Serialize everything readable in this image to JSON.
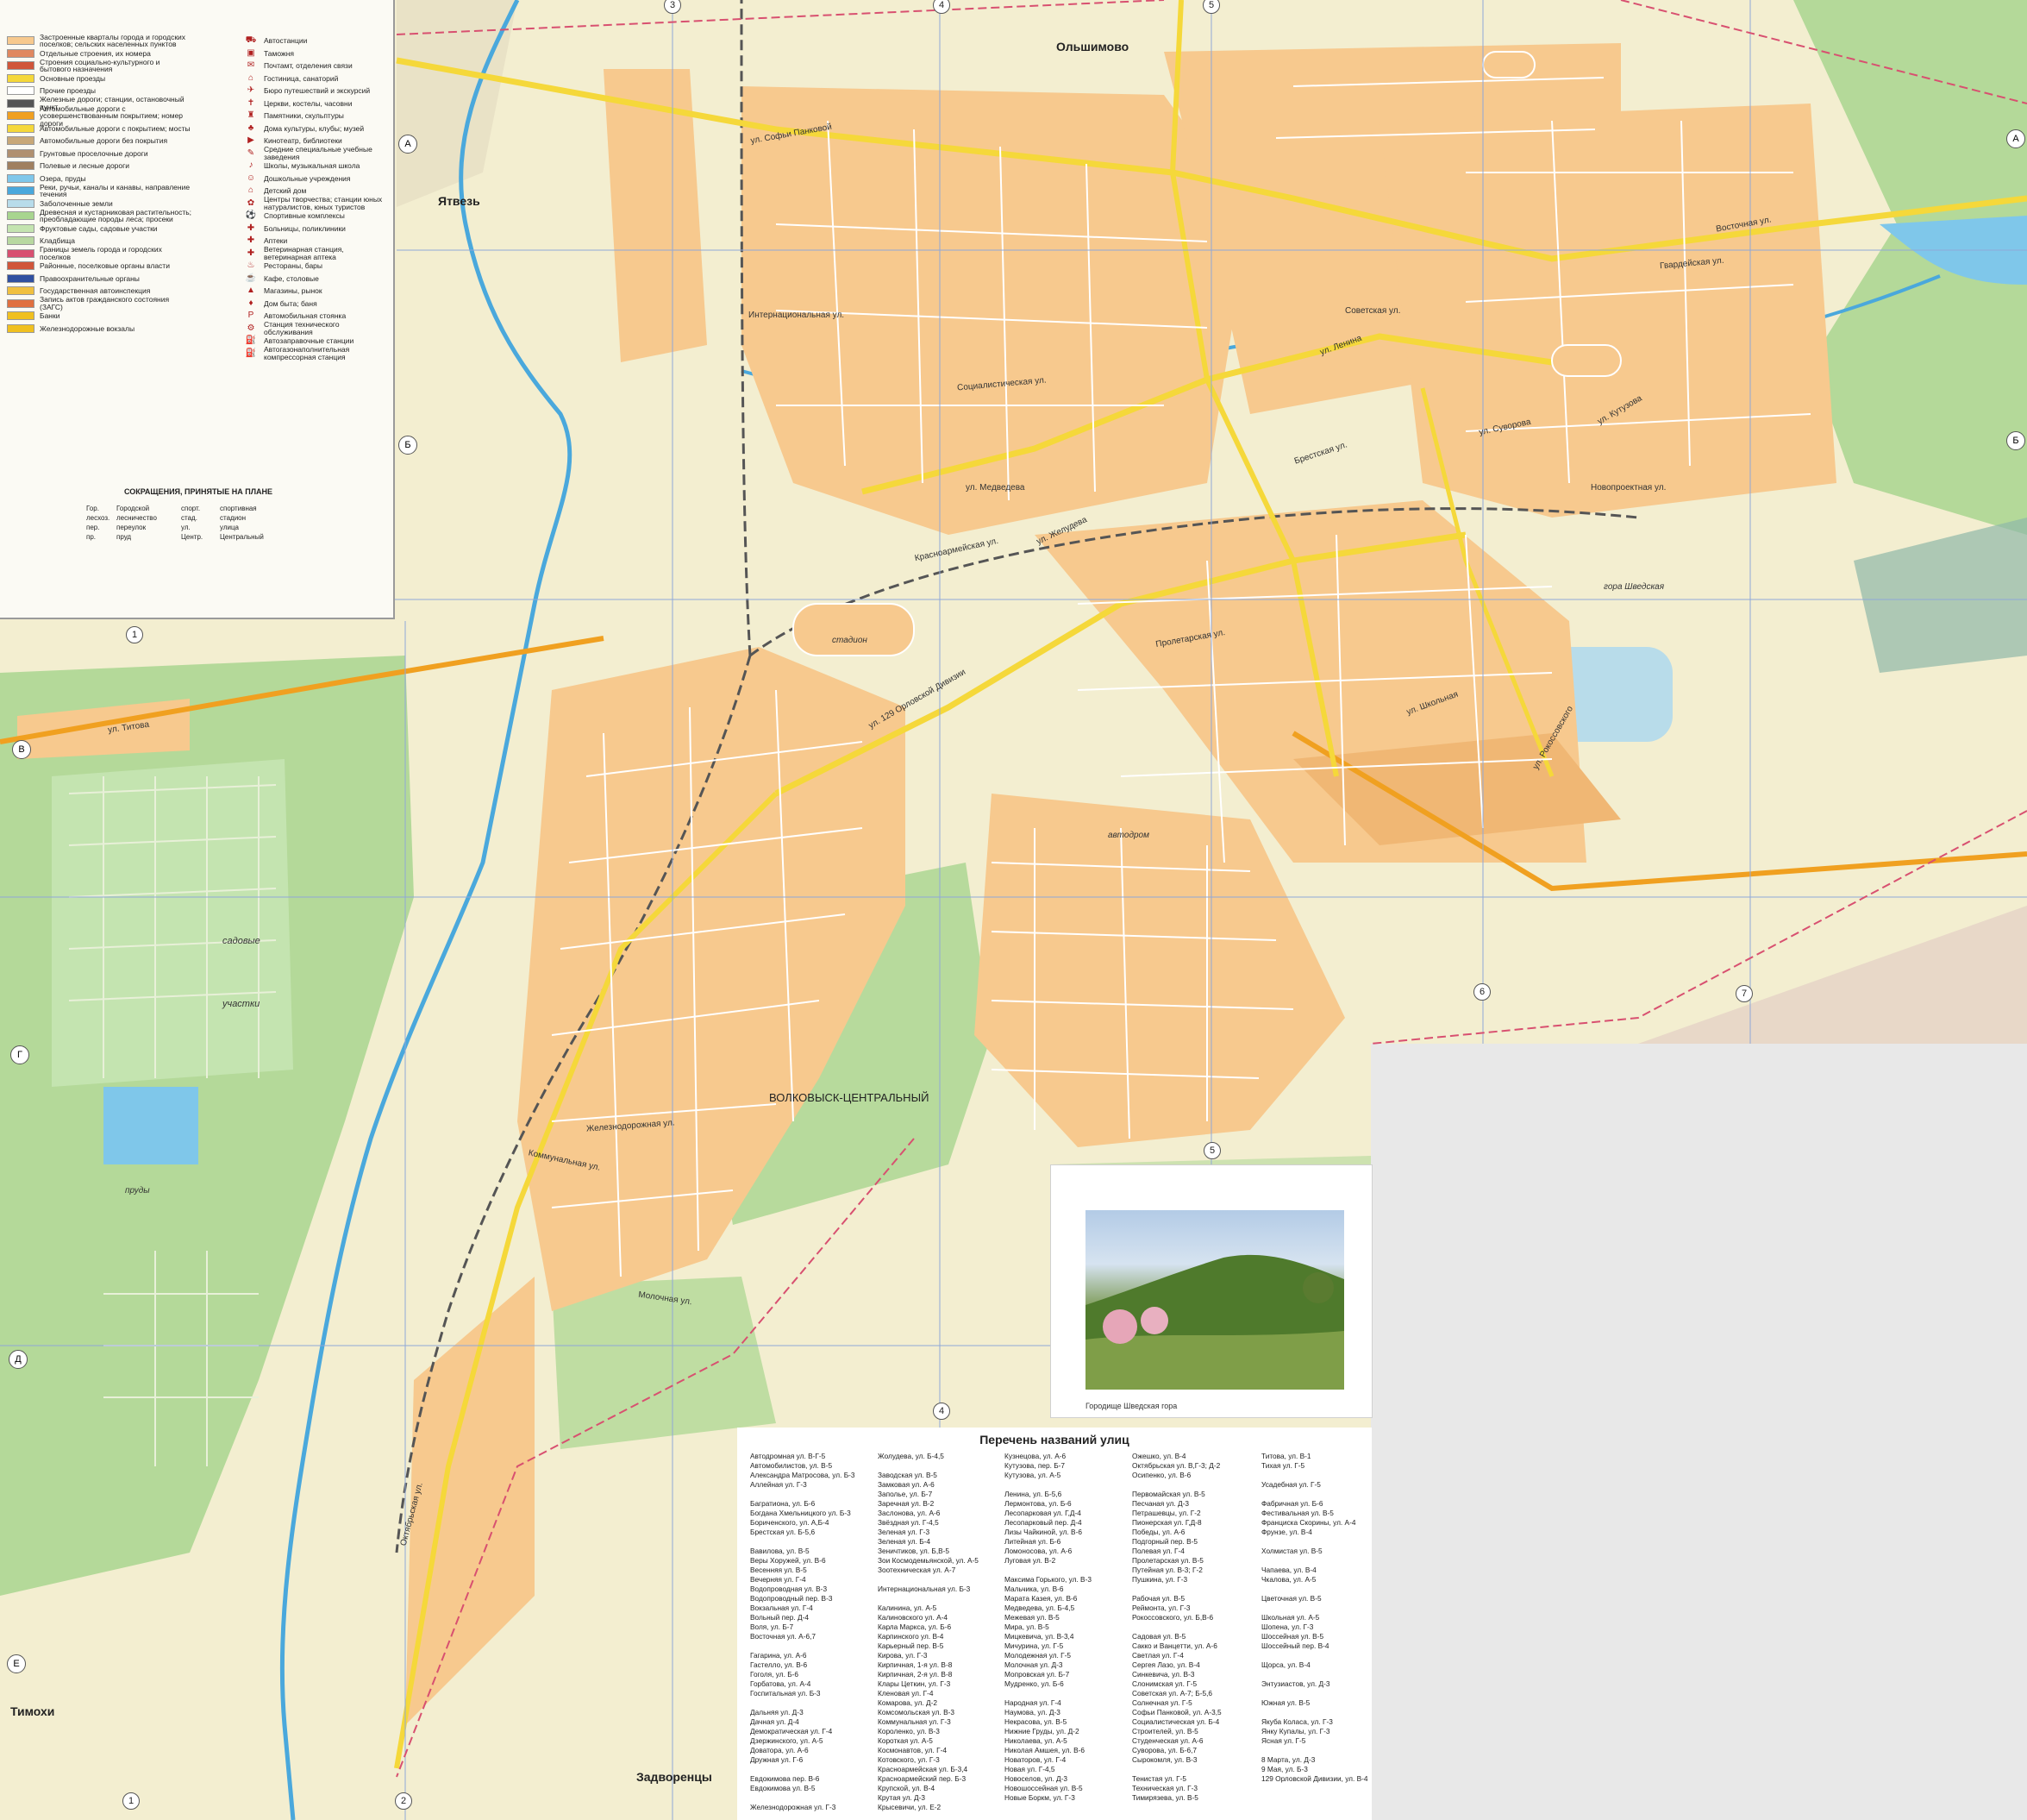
{
  "colors": {
    "background": "#f3eed0",
    "urban": "#f7c98e",
    "residential": "#f0b774",
    "green": "#a8d58f",
    "water": "#7fc7ea",
    "main_road": "#f5d83a",
    "rail": "#555555"
  },
  "legend": {
    "items_left": [
      {
        "label": "Застроенные кварталы города и городских поселков; сельских населенных пунктов",
        "swatch": "#f7c98e"
      },
      {
        "label": "Отдельные строения, их номера",
        "swatch": "#e08860"
      },
      {
        "label": "Строения социально-культурного и бытового назначения",
        "swatch": "#d0563a"
      },
      {
        "label": "Основные проезды",
        "swatch": "#f5d83a"
      },
      {
        "label": "Прочие проезды",
        "swatch": "#ffffff"
      },
      {
        "label": "Железные дороги; станции, остановочный пункт",
        "swatch": "#555555"
      },
      {
        "label": "Автомобильные дороги с усовершенствованным покрытием; номер дороги",
        "swatch": "#f0a020"
      },
      {
        "label": "Автомобильные дороги с покрытием; мосты",
        "swatch": "#f5d83a"
      },
      {
        "label": "Автомобильные дороги без покрытия",
        "swatch": "#c8a878"
      },
      {
        "label": "Грунтовые проселочные дороги",
        "swatch": "#b09070"
      },
      {
        "label": "Полевые и лесные дороги",
        "swatch": "#a08060"
      },
      {
        "label": "Озера, пруды",
        "swatch": "#7fc7ea"
      },
      {
        "label": "Реки, ручьи, каналы и канавы, направление течения",
        "swatch": "#4aa8dc"
      },
      {
        "label": "Заболоченные земли",
        "swatch": "#b8dcea"
      },
      {
        "label": "Древесная и кустарниковая растительность; преобладающие породы леса; просеки",
        "swatch": "#a8d58f"
      },
      {
        "label": "Фруктовые сады, садовые участки",
        "swatch": "#c4e4b0"
      },
      {
        "label": "Кладбища",
        "swatch": "#b8d8a0"
      },
      {
        "label": "Границы земель города и городских поселков",
        "swatch": "#d85070"
      },
      {
        "label": "Районные, поселковые органы власти",
        "swatch": "#d0563a"
      },
      {
        "label": "Правоохранительные органы",
        "swatch": "#3050a0"
      },
      {
        "label": "Государственная автоинспекция",
        "swatch": "#f0c040"
      },
      {
        "label": "Запись актов гражданского состояния (ЗАГС)",
        "swatch": "#e07040"
      },
      {
        "label": "Банки",
        "swatch": "#f0c020"
      },
      {
        "label": "Железнодорожные вокзалы",
        "swatch": "#f0c020"
      }
    ],
    "items_right": [
      {
        "label": "Автостанции",
        "icon": "⛟"
      },
      {
        "label": "Таможня",
        "icon": "▣"
      },
      {
        "label": "Почтамт, отделения связи",
        "icon": "✉"
      },
      {
        "label": "Гостиница, санаторий",
        "icon": "⌂"
      },
      {
        "label": "Бюро путешествий и экскурсий",
        "icon": "✈"
      },
      {
        "label": "Церкви, костелы, часовни",
        "icon": "✝"
      },
      {
        "label": "Памятники, скульптуры",
        "icon": "♜"
      },
      {
        "label": "Дома культуры, клубы; музей",
        "icon": "♣"
      },
      {
        "label": "Кинотеатр, библиотеки",
        "icon": "▶"
      },
      {
        "label": "Средние специальные учебные заведения",
        "icon": "✎"
      },
      {
        "label": "Школы, музыкальная школа",
        "icon": "♪"
      },
      {
        "label": "Дошкольные учреждения",
        "icon": "☺"
      },
      {
        "label": "Детский дом",
        "icon": "⌂"
      },
      {
        "label": "Центры творчества; станции юных натуралистов, юных туристов",
        "icon": "✿"
      },
      {
        "label": "Спортивные комплексы",
        "icon": "⚽"
      },
      {
        "label": "Больницы, поликлиники",
        "icon": "✚"
      },
      {
        "label": "Аптеки",
        "icon": "✚"
      },
      {
        "label": "Ветеринарная станция, ветеринарная аптека",
        "icon": "✚"
      },
      {
        "label": "Рестораны, бары",
        "icon": "♨"
      },
      {
        "label": "Кафе, столовые",
        "icon": "☕"
      },
      {
        "label": "Магазины, рынок",
        "icon": "▲"
      },
      {
        "label": "Дом быта; баня",
        "icon": "♦"
      },
      {
        "label": "Автомобильная стоянка",
        "icon": "P"
      },
      {
        "label": "Станция технического обслуживания",
        "icon": "⚙"
      },
      {
        "label": "Автозаправочные станции",
        "icon": "⛽"
      },
      {
        "label": "Автогазонаполнительная компрессорная станция",
        "icon": "⛽"
      }
    ],
    "abbreviations_title": "СОКРАЩЕНИЯ, ПРИНЯТЫЕ НА ПЛАНЕ",
    "abbreviations": [
      [
        "Гор.",
        "Городской",
        "спорт.",
        "спортивная"
      ],
      [
        "лесхоз.",
        "лесничество",
        "стад.",
        "стадион"
      ],
      [
        "пер.",
        "переулок",
        "ул.",
        "улица"
      ],
      [
        "пр.",
        "пруд",
        "Центр.",
        "Центральный"
      ]
    ]
  },
  "places": {
    "olshimovo": "Ольшимово",
    "yatvez": "Ятвезь",
    "timokhi": "Тимохи",
    "zadvorentsy": "Задворенцы",
    "volkovysk_central": "ВОЛКОВЫСК-ЦЕНТРАЛЬНЫЙ",
    "gora_shvedskaya": "гора Шведская",
    "sadovye": "садовые",
    "uchastki": "участки",
    "avtodrom": "автодром",
    "prudy": "пруды",
    "stadion": "стадион"
  },
  "streets": {
    "sofi_pankovoy": "ул. Софьи Панковой",
    "sovetskaya": "Советская ул.",
    "lenina": "ул. Ленина",
    "suvorova": "ул. Суворова",
    "kutuzova": "ул. Кутузова",
    "brestskaya": "Брестская ул.",
    "zheludeva": "ул. Желудева",
    "medvedeva": "ул. Медведева",
    "orlovskoy": "ул. 129 Орловской Дивизии",
    "oktyabrskaya": "Октябрьская ул.",
    "titova": "ул. Титова",
    "internatsionalnaya": "Интернациональная ул.",
    "sotsialisticheskaya": "Социалистическая ул.",
    "krasnoarmeyskaya": "Красноармейская ул.",
    "novoproektnaya": "Новопроектная ул.",
    "proletarskaya": "Пролетарская ул.",
    "rokossovskogo": "ул. Рокоссовского",
    "shkolnaya": "ул. Школьная",
    "gvardeyskaya": "Гвардейская ул.",
    "vostochnaya": "Восточная ул.",
    "kommunalnaya": "Коммунальная ул.",
    "zheleznodorozhnaya": "Железнодорожная ул.",
    "molochnaya": "Молочная ул."
  },
  "grid_numbers": {
    "top": [
      "3",
      "4",
      "5"
    ],
    "left_letters": [
      "А",
      "Б",
      "В",
      "Г",
      "Д",
      "Е"
    ],
    "right_letters": [
      "А",
      "Б"
    ],
    "bottom": [
      "1",
      "2",
      "4",
      "5",
      "6",
      "7"
    ],
    "lower_mid": [
      "1",
      "6",
      "7"
    ]
  },
  "photo_caption": "Городище Шведская гора",
  "street_index": {
    "title": "Перечень названий улиц",
    "columns": [
      [
        "Автодромная ул. В-Г-5",
        "Автомобилистов, ул. В-5",
        "Александра Матросова, ул. Б-3",
        "Аллейная ул. Г-3",
        "",
        "Багратиона, ул. Б-6",
        "Богдана Хмельницкого ул. Б-3",
        "Бориченского, ул. А,Б-4",
        "Брестская ул. Б-5,6",
        "",
        "Вавилова, ул. В-5",
        "Веры Хоружей, ул. В-6",
        "Весенняя ул. В-5",
        "Вечерняя ул. Г-4",
        "Водопроводная ул. В-3",
        "Водопроводный пер. В-3",
        "Вокзальная ул. Г-4",
        "Вольный пер. Д-4",
        "Воля, ул. Б-7",
        "Восточная ул. А-6,7",
        "",
        "Гагарина, ул. А-6",
        "Гастелло, ул. В-6",
        "Гоголя, ул. Б-6",
        "Горбатова, ул. А-4",
        "Госпитальная ул. Б-3",
        "",
        "Дальняя ул. Д-3",
        "Дачная ул. Д-4",
        "Демократическая ул. Г-4",
        "Дзержинского, ул. А-5",
        "Доватора, ул. А-6",
        "Дружная ул. Г-6",
        "",
        "Евдокимова пер. В-6",
        "Евдокимова ул. В-5",
        "",
        "Железнодорожная ул. Г-3"
      ],
      [
        "Жолудева, ул. Б-4,5",
        "",
        "Заводская ул. В-5",
        "Замковая ул. А-6",
        "Заполье, ул. Б-7",
        "Заречная ул. В-2",
        "Заслонова, ул. А-6",
        "Звёздная ул. Г-4,5",
        "Зеленая ул. Г-3",
        "Зеленая ул. Б-4",
        "Зеничтиков, ул. Б,В-5",
        "Зои Космодемьянской, ул. А-5",
        "Зоотехническая ул. А-7",
        "",
        "Интернациональная ул. Б-3",
        "",
        "Калинина, ул. А-5",
        "Калиновского ул. А-4",
        "Карла Маркса, ул. Б-6",
        "Карпинского ул. В-4",
        "Карьерный пер. В-5",
        "Кирова, ул. Г-3",
        "Кирпичная, 1-я ул. В-8",
        "Кирпичная, 2-я ул. В-8",
        "Клары Цеткин, ул. Г-3",
        "Кленовая ул. Г-4",
        "Комарова, ул. Д-2",
        "Комсомольская ул. В-3",
        "Коммунальная ул. Г-3",
        "Короленко, ул. В-3",
        "Короткая ул. А-5",
        "Космонавтов, ул. Г-4",
        "Котовского, ул. Г-3",
        "Красноармейская ул. Б-3,4",
        "Красноармейский пер. Б-3",
        "Крупской, ул. В-4",
        "Крутая ул. Д-3",
        "Крысевичи, ул. Е-2"
      ],
      [
        "Кузнецова, ул. А-6",
        "Кутузова, пер. Б-7",
        "Кутузова, ул. А-5",
        "",
        "Ленина, ул. Б-5,6",
        "Лермонтова, ул. Б-6",
        "Лесопарковая ул. Г,Д-4",
        "Лесопарковый пер. Д-4",
        "Лизы Чайкиной, ул. В-6",
        "Литейная ул. Б-6",
        "Ломоносова, ул. А-6",
        "Луговая ул. В-2",
        "",
        "Максима Горького, ул. В-3",
        "Мальчика, ул. В-6",
        "Марата Казея, ул. В-6",
        "Медведева, ул. Б-4,5",
        "Межевая ул. В-5",
        "Мира, ул. В-5",
        "Мицкевича, ул. В-3,4",
        "Мичурина, ул. Г-5",
        "Молодежная ул. Г-5",
        "Молочная ул. Д-3",
        "Мопровская ул. Б-7",
        "Мудренко, ул. Б-6",
        "",
        "Народная ул. Г-4",
        "Наумова, ул. Д-3",
        "Некрасова, ул. В-5",
        "Нижние Груды, ул. Д-2",
        "Николаева, ул. А-5",
        "Николая Амшея, ул. В-6",
        "Новаторов, ул. Г-4",
        "Новая ул. Г-4,5",
        "Новоселов, ул. Д-3",
        "Новошоссейная ул. В-5",
        "Новые Боркм, ул. Г-3"
      ],
      [
        "Ожешко, ул. В-4",
        "Октябрьская ул. В,Г-3; Д-2",
        "Осипенко, ул. В-6",
        "",
        "Первомайская ул. В-5",
        "Песчаная ул. Д-3",
        "Петрашевцы, ул. Г-2",
        "Пионерская ул. Г,Д-8",
        "Победы, ул. А-6",
        "Подгорный пер. В-5",
        "Полевая ул. Г-4",
        "Пролетарская ул. В-5",
        "Путейная ул. В-3; Г-2",
        "Пушкина, ул. Г-3",
        "",
        "Рабочая ул. В-5",
        "Реймонта, ул. Г-3",
        "Рокоссовского, ул. Б,В-6",
        "",
        "Садовая ул. В-5",
        "Сакко и Ванцетти, ул. А-6",
        "Светлая ул. Г-4",
        "Сергея Лазо, ул. В-4",
        "Синкевича, ул. В-3",
        "Слонимская ул. Г-5",
        "Советская ул. А-7; Б-5,6",
        "Солнечная ул. Г-5",
        "Софьи Панковой, ул. А-3,5",
        "Социалистическая ул. Б-4",
        "Строителей, ул. В-5",
        "Студенческая ул. А-6",
        "Суворова, ул. Б-6,7",
        "Сырокомля, ул. В-3",
        "",
        "Тенистая ул. Г-5",
        "Техническая ул. Г-3",
        "Тимирязева, ул. В-5"
      ],
      [
        "Титова, ул. В-1",
        "Тихая ул. Г-5",
        "",
        "Усадебная ул. Г-5",
        "",
        "Фабричная ул. Б-6",
        "Фестивальная ул. В-5",
        "Франциска Скорины, ул. А-4",
        "Фрунзе, ул. В-4",
        "",
        "Холмистая ул. В-5",
        "",
        "Чапаева, ул. В-4",
        "Чкалова, ул. А-5",
        "",
        "Цветочная ул. В-5",
        "",
        "Школьная ул. А-5",
        "Шопена, ул. Г-3",
        "Шоссейная ул. В-5",
        "Шоссейный пер. В-4",
        "",
        "Щорса, ул. В-4",
        "",
        "Энтузиастов, ул. Д-3",
        "",
        "Южная ул. В-5",
        "",
        "Якуба Коласа, ул. Г-3",
        "Янку Купалы, ул. Г-3",
        "Ясная ул. Г-5",
        "",
        "8 Марта, ул. Д-3",
        "9 Мая, ул. Б-3",
        "129 Орловской Дивизии, ул. В-4"
      ]
    ]
  }
}
